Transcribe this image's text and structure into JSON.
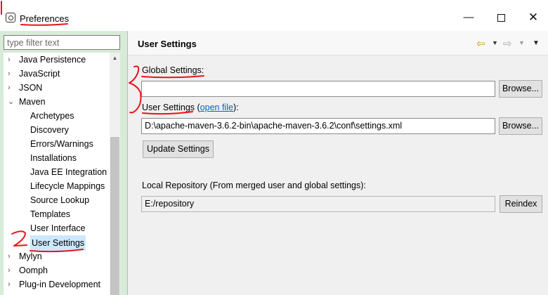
{
  "window": {
    "title": "Preferences",
    "minimize_glyph": "—",
    "close_glyph": "✕"
  },
  "sidebar": {
    "filter_placeholder": "type filter text",
    "items": [
      {
        "label": "Java Persistence",
        "twisty": "›"
      },
      {
        "label": "JavaScript",
        "twisty": "›"
      },
      {
        "label": "JSON",
        "twisty": "›"
      },
      {
        "label": "Maven",
        "twisty": "⌄"
      },
      {
        "label": "Archetypes"
      },
      {
        "label": "Discovery"
      },
      {
        "label": "Errors/Warnings"
      },
      {
        "label": "Installations"
      },
      {
        "label": "Java EE Integration"
      },
      {
        "label": "Lifecycle Mappings"
      },
      {
        "label": "Source Lookup"
      },
      {
        "label": "Templates"
      },
      {
        "label": "User Interface"
      },
      {
        "label": "User Settings"
      },
      {
        "label": "Mylyn",
        "twisty": "›"
      },
      {
        "label": "Oomph",
        "twisty": "›"
      },
      {
        "label": "Plug-in Development",
        "twisty": "›"
      }
    ],
    "selected": "User Settings",
    "scroll_up_glyph": "▲"
  },
  "main": {
    "page_title": "User Settings",
    "nav": {
      "back_icon": "⇦",
      "forward_icon": "⇨",
      "dropdown_glyph": "▼",
      "menu_glyph": "▼"
    },
    "global_settings": {
      "label": "Global Settings:",
      "value": "",
      "browse_label": "Browse..."
    },
    "user_settings": {
      "label_prefix": "User Settings (",
      "link_text": "open file",
      "label_suffix": "):",
      "value": "D:\\apache-maven-3.6.2-bin\\apache-maven-3.6.2\\conf\\settings.xml",
      "browse_label": "Browse..."
    },
    "update_button_label": "Update Settings",
    "local_repository": {
      "label": "Local Repository (From merged user and global settings):",
      "value": "E:/repository",
      "reindex_label": "Reindex"
    }
  },
  "colors": {
    "sidebar_bg": "#d8ead8",
    "selection": "#cce8ff",
    "link": "#0a60c0",
    "annotation": "#e8141c",
    "back_arrow": "#c79a1a"
  }
}
